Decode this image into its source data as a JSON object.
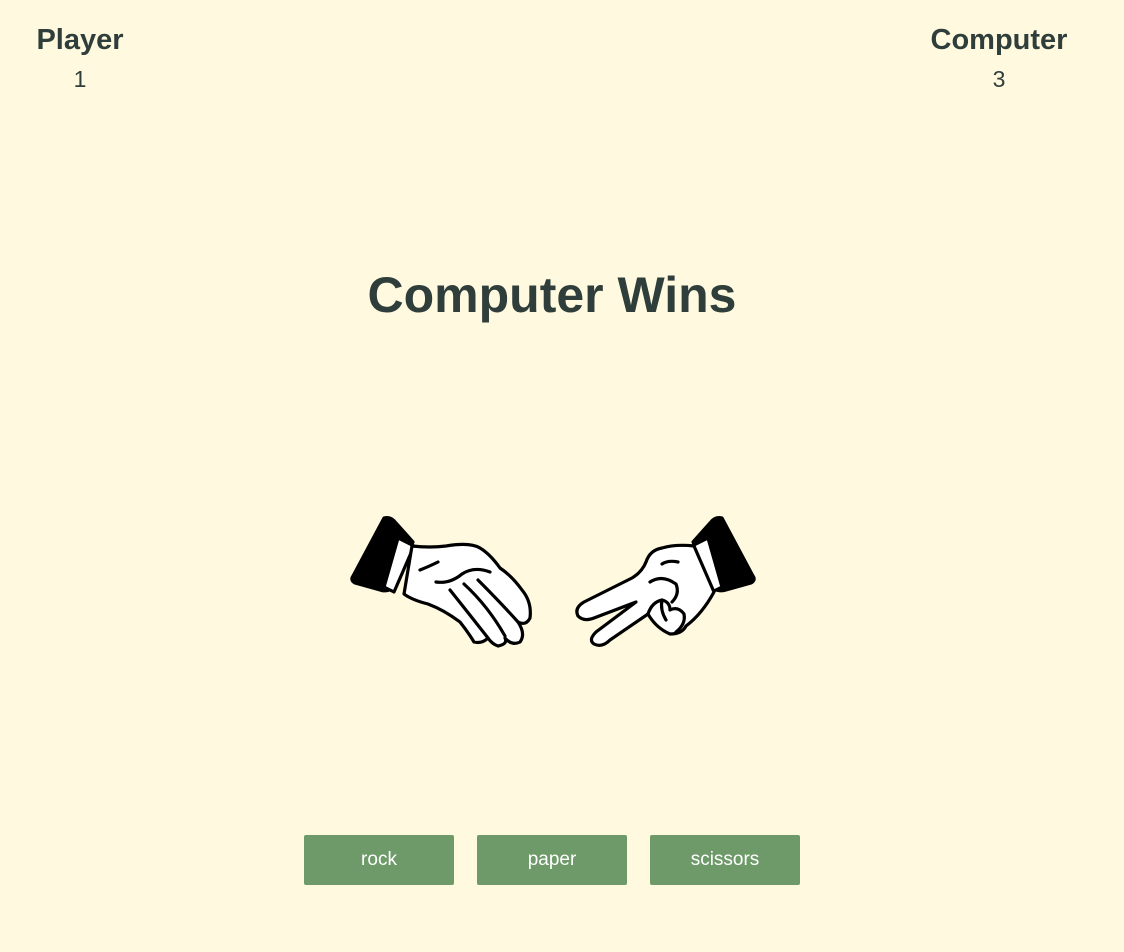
{
  "scoreboard": {
    "player": {
      "label": "Player",
      "score": "1"
    },
    "computer": {
      "label": "Computer",
      "score": "3"
    }
  },
  "result": {
    "text": "Computer Wins"
  },
  "hands": {
    "player_choice": "paper",
    "computer_choice": "scissors"
  },
  "choices": [
    {
      "label": "rock"
    },
    {
      "label": "paper"
    },
    {
      "label": "scissors"
    }
  ],
  "colors": {
    "background": "#fffadf",
    "text": "#2f3e3b",
    "button": "#6d9a68",
    "button_text": "#ffffff"
  }
}
